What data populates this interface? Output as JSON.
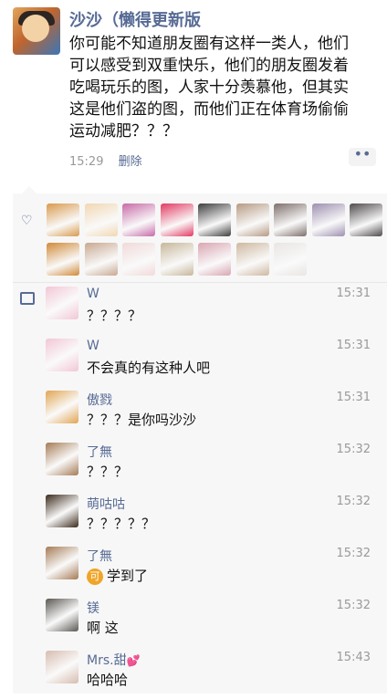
{
  "post": {
    "author": "沙沙（懒得更新版",
    "text": "你可能不知道朋友圈有这样一类人，他们\n可以感受到双重快乐，他们的朋友圈发着\n吃喝玩乐的图，人家十分羡慕他，但其实\n这是他们盗的图，而他们正在体育场偷偷\n运动减肥？？？",
    "time": "15:29",
    "delete_label": "删除",
    "more_label": "••"
  },
  "likes": {
    "colors": [
      "#d99a4d",
      "#f1d7b2",
      "#c76aa8",
      "#e23a62",
      "#3d3d3d",
      "#b69a83",
      "#7d6f6a",
      "#9d8fb0",
      "#4f4a4d",
      "#d08a38",
      "#c8a890",
      "#f1d9d9",
      "#c7b79a",
      "#d9a6b2",
      "#ceb8a0",
      "#e9e5e3"
    ]
  },
  "comments": [
    {
      "name": "W",
      "time": "15:31",
      "text": "？？？？",
      "ava": "#f2c6d6"
    },
    {
      "name": "W",
      "time": "15:31",
      "text": "不会真的有这种人吧",
      "ava": "#f2c6d6"
    },
    {
      "name": "傲戮",
      "time": "15:31",
      "text": "？？？是你吗沙沙",
      "ava": "#e1a552"
    },
    {
      "name": "了無",
      "time": "15:32",
      "text": "？？？",
      "ava": "#a57b55"
    },
    {
      "name": "萌咕咕",
      "time": "15:32",
      "text": "？？？？？",
      "ava": "#3b2a1b"
    },
    {
      "name": "了無",
      "time": "15:32",
      "text": "学到了",
      "ava": "#a57b55",
      "coin": "可"
    },
    {
      "name": "镁",
      "time": "15:32",
      "text": "啊 这",
      "ava": "#5a5752"
    },
    {
      "name": "Mrs.甜",
      "time": "15:43",
      "text": "哈哈哈",
      "ava": "#d6bcae",
      "heart": "💕"
    }
  ]
}
